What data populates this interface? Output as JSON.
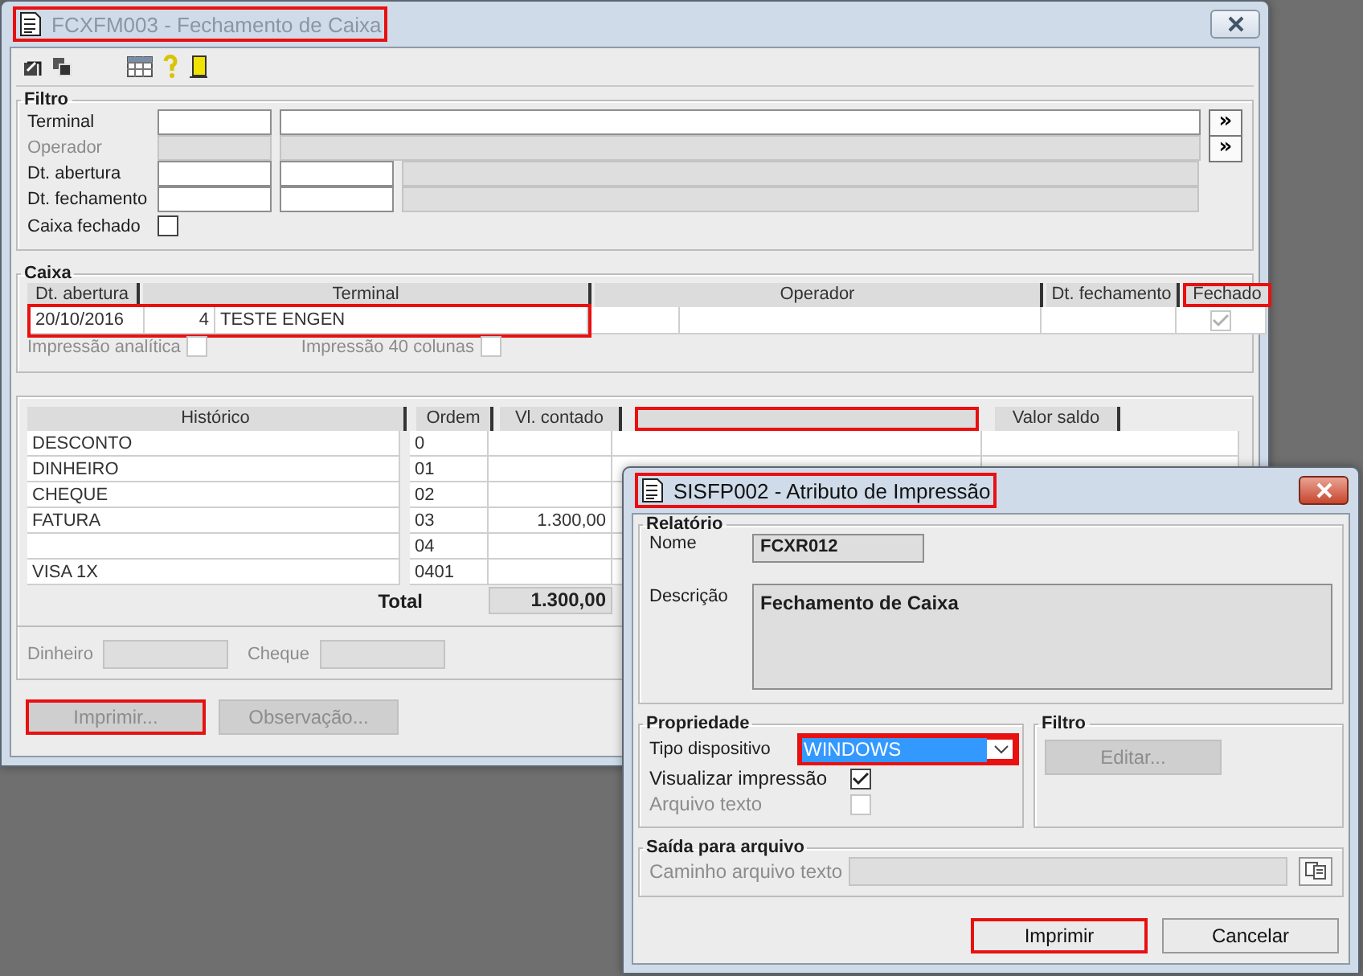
{
  "main_window": {
    "title": "FCXFM003 - Fechamento de Caixa",
    "active": false,
    "title_highlighted": true,
    "filtro": {
      "title": "Filtro",
      "rows": [
        {
          "kind": "lookup",
          "label": "Terminal",
          "disabled": false,
          "button": "»"
        },
        {
          "kind": "lookup",
          "label": "Operador",
          "disabled": true,
          "button": "»"
        },
        {
          "kind": "range",
          "label": "Dt. abertura",
          "disabled": false
        },
        {
          "kind": "range",
          "label": "Dt. fechamento",
          "disabled": false
        },
        {
          "kind": "check",
          "label": "Caixa fechado",
          "checked": false
        }
      ]
    },
    "caixa": {
      "title": "Caixa",
      "columns": [
        {
          "label": "Dt. abertura",
          "highlighted": false
        },
        {
          "label": "Terminal",
          "highlighted": false
        },
        {
          "label": "Operador",
          "highlighted": false
        },
        {
          "label": "Dt. fechamento",
          "highlighted": false
        },
        {
          "label": "Fechado",
          "highlighted": true
        }
      ],
      "rows": [
        {
          "dt_abertura": "20/10/2016",
          "code": "4",
          "terminal": "TESTE ENGEN",
          "fechado": true,
          "highlighted": true
        }
      ],
      "options": [
        {
          "label": "Impressão analítica",
          "checked": false
        },
        {
          "label": "Impressão 40 colunas",
          "checked": false
        }
      ]
    },
    "movimento": {
      "columns": [
        {
          "label": "Histórico",
          "highlighted": false
        },
        {
          "label": "Ordem",
          "highlighted": false
        },
        {
          "label": "Vl. contado",
          "highlighted": false
        },
        {
          "highlighted": true
        },
        {
          "label": "Valor saldo",
          "highlighted": false
        }
      ],
      "rows": [
        {
          "historico": "DESCONTO",
          "ordem": "0"
        },
        {
          "historico": "DINHEIRO",
          "ordem": "01"
        },
        {
          "historico": "CHEQUE",
          "ordem": "02"
        },
        {
          "historico": "FATURA",
          "ordem": "03",
          "vl_contado": "1.300,00"
        },
        {
          "ordem": "04"
        },
        {
          "historico": "VISA 1X",
          "ordem": "0401"
        }
      ],
      "total_label": "Total",
      "total": "1.300,00",
      "fields": [
        {
          "label": "Dinheiro"
        },
        {
          "label": "Cheque"
        }
      ]
    },
    "buttons": [
      {
        "label": "Imprimir...",
        "disabled": true,
        "highlighted": true
      },
      {
        "label": "Observação...",
        "disabled": true,
        "highlighted": false
      }
    ]
  },
  "dialog": {
    "title": "SISFP002 - Atributo de Impressão",
    "active": true,
    "title_highlighted": true,
    "relatorio": {
      "title": "Relatório",
      "nome_label": "Nome",
      "nome": "FCXR012",
      "descricao_label": "Descrição",
      "descricao": "Fechamento de Caixa"
    },
    "propriedade": {
      "title": "Propriedade",
      "tipo_label": "Tipo dispositivo",
      "tipo_value": "WINDOWS",
      "tipo_highlighted": true,
      "options": [
        {
          "label": "Visualizar impressão",
          "checked": true,
          "disabled": false
        },
        {
          "label": "Arquivo texto",
          "checked": false,
          "disabled": true
        }
      ]
    },
    "filtro": {
      "title": "Filtro",
      "button": "Editar...",
      "disabled": true
    },
    "saida": {
      "title": "Saída para arquivo",
      "label": "Caminho arquivo texto",
      "disabled": true
    },
    "buttons": [
      {
        "label": "Imprimir",
        "default": true,
        "highlighted": true
      },
      {
        "label": "Cancelar",
        "default": false,
        "highlighted": false
      }
    ]
  }
}
